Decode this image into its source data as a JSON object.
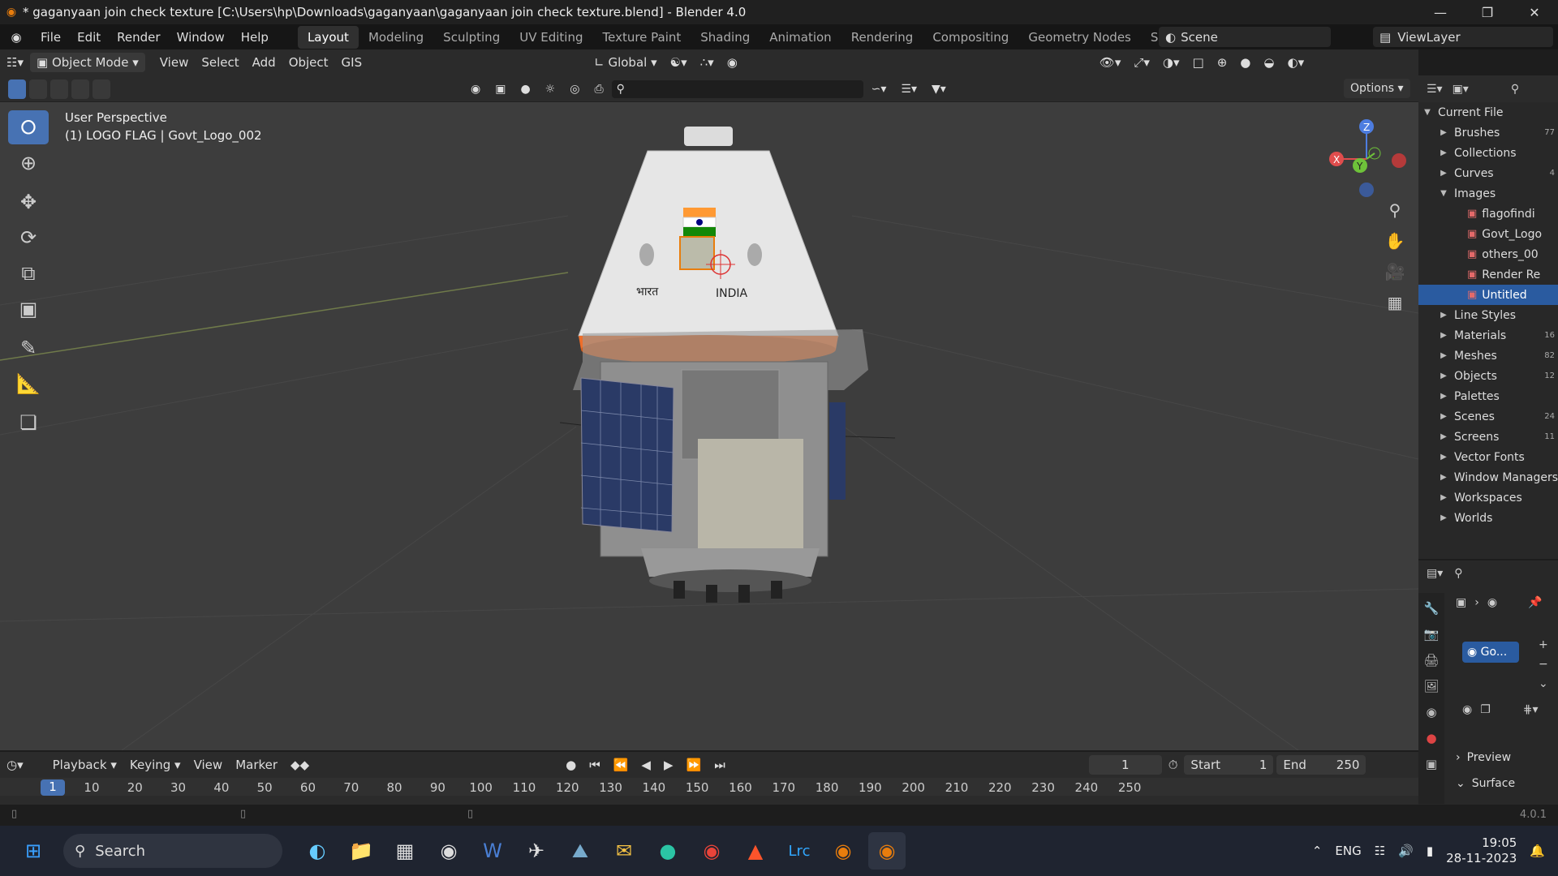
{
  "window": {
    "title": "* gaganyaan join check texture [C:\\Users\\hp\\Downloads\\gaganyaan\\gaganyaan join check texture.blend] - Blender 4.0"
  },
  "menu": [
    "File",
    "Edit",
    "Render",
    "Window",
    "Help"
  ],
  "workspaces": [
    "Layout",
    "Modeling",
    "Sculpting",
    "UV Editing",
    "Texture Paint",
    "Shading",
    "Animation",
    "Rendering",
    "Compositing",
    "Geometry Nodes",
    "Scripting"
  ],
  "scene": "Scene",
  "view_layer": "ViewLayer",
  "header": {
    "mode": "Object Mode",
    "menus": [
      "View",
      "Select",
      "Add",
      "Object",
      "GIS"
    ],
    "orientation": "Global",
    "options": "Options"
  },
  "viewport": {
    "view_name": "User Perspective",
    "object_info": "(1) LOGO FLAG | Govt_Logo_002",
    "label_hindi": "भारत",
    "label_india": "INDIA",
    "axes": {
      "z": "Z",
      "y": "Y",
      "x": "X"
    }
  },
  "outliner": {
    "root": "Current File",
    "items": [
      {
        "label": "Brushes",
        "count": "77",
        "exp": false
      },
      {
        "label": "Collections",
        "count": "",
        "exp": false
      },
      {
        "label": "Curves",
        "count": "4",
        "exp": false
      },
      {
        "label": "Images",
        "count": "",
        "exp": true
      },
      {
        "label": "flagofindi",
        "child": true
      },
      {
        "label": "Govt_Logo",
        "child": true
      },
      {
        "label": "others_00",
        "child": true
      },
      {
        "label": "Render Re",
        "child": true
      },
      {
        "label": "Untitled",
        "child": true,
        "selected": true
      },
      {
        "label": "Line Styles",
        "count": "",
        "exp": false
      },
      {
        "label": "Materials",
        "count": "16",
        "exp": false
      },
      {
        "label": "Meshes",
        "count": "82",
        "exp": false
      },
      {
        "label": "Objects",
        "count": "12",
        "exp": false
      },
      {
        "label": "Palettes",
        "count": "",
        "exp": false
      },
      {
        "label": "Scenes",
        "count": "24",
        "exp": false
      },
      {
        "label": "Screens",
        "count": "11",
        "exp": false
      },
      {
        "label": "Vector Fonts",
        "count": "",
        "exp": false
      },
      {
        "label": "Window Managers",
        "count": "",
        "exp": false
      },
      {
        "label": "Workspaces",
        "count": "",
        "exp": false
      },
      {
        "label": "Worlds",
        "count": "",
        "exp": false
      }
    ]
  },
  "properties": {
    "material_slot": "Go...",
    "preview": "Preview",
    "surface": "Surface"
  },
  "timeline": {
    "menus": [
      "Playback",
      "Keying",
      "View",
      "Marker"
    ],
    "current_frame": "1",
    "start_label": "Start",
    "start": "1",
    "end_label": "End",
    "end": "250",
    "ticks": [
      "10",
      "20",
      "30",
      "40",
      "50",
      "60",
      "70",
      "80",
      "90",
      "100",
      "110",
      "120",
      "130",
      "140",
      "150",
      "160",
      "170",
      "180",
      "190",
      "200",
      "210",
      "220",
      "230",
      "240",
      "250"
    ]
  },
  "status": {
    "version": "4.0.1"
  },
  "taskbar": {
    "search": "Search",
    "lang": "ENG",
    "time": "19:05",
    "date": "28-11-2023"
  },
  "colors": {
    "accent": "#4772b3",
    "selected": "#2a5ba0",
    "orange": "#e87d0d"
  }
}
